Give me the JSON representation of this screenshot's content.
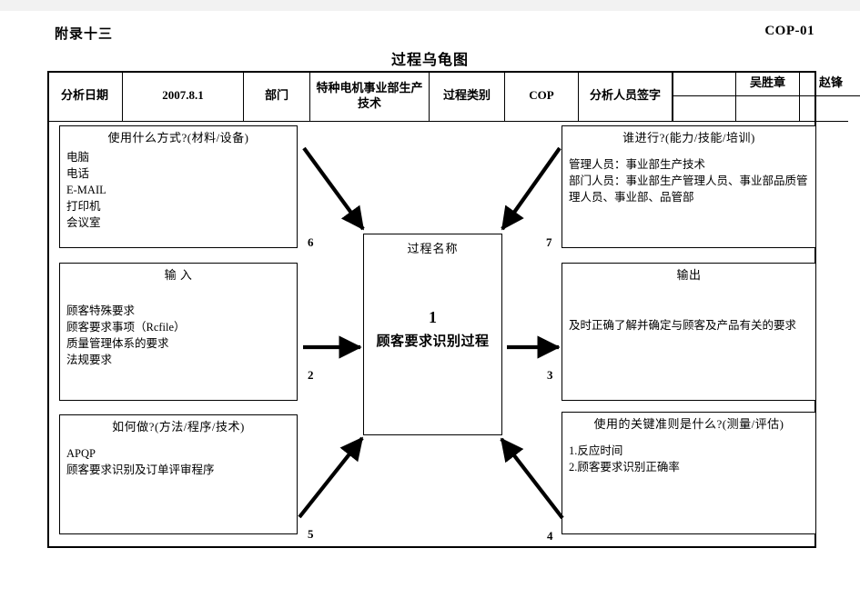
{
  "page": {
    "appendix_label": "附录十三",
    "doc_code": "COP-01",
    "title": "过程乌龟图"
  },
  "header": {
    "date_label": "分析日期",
    "date_value": "2007.8.1",
    "dept_label": "部门",
    "dept_value": "特种电机事业部生产技术",
    "process_type_label": "过程类别",
    "process_type_value": "COP",
    "signature_label": "分析人员签字",
    "signature_cells": [
      {
        "blank": "",
        "name": "吴胜章",
        "name2": "赵锋"
      }
    ],
    "signer_blank": "",
    "signer_1": "吴胜章",
    "signer_2": "赵锋",
    "signer_row2_blank1": "",
    "signer_row2_blank2": "",
    "signer_row2_blank3": ""
  },
  "turtle": {
    "methods": {
      "title": "使用什么方式?(材料/设备)",
      "lines": [
        "电脑",
        "电话",
        "E-MAIL",
        "打印机",
        "会议室"
      ]
    },
    "who": {
      "title": "谁进行?(能力/技能/培训)",
      "lines": [
        "管理人员：事业部生产技术",
        "部门人员：事业部生产管理人员、事业部品质管",
        "理人员、事业部、品管部"
      ]
    },
    "input": {
      "title": "输  入",
      "lines": [
        "顾客特殊要求",
        "顾客要求事项（Rcfile）",
        "质量管理体系的要求",
        "法规要求"
      ]
    },
    "output": {
      "title": "输出",
      "lines": [
        "及时正确了解并确定与顾客及产品有关的要求"
      ]
    },
    "how": {
      "title": "如何做?(方法/程序/技术)",
      "lines": [
        "APQP",
        "顾客要求识别及订单评审程序"
      ]
    },
    "criteria": {
      "title": "使用的关键准则是什么?(测量/评估)",
      "lines": [
        "1.反应时间",
        "2.顾客要求识别正确率"
      ]
    },
    "center": {
      "title": "过程名称",
      "number": "1",
      "name": "顾客要求识别过程"
    }
  },
  "arrow_labels": {
    "n2": "2",
    "n3": "3",
    "n4": "4",
    "n5": "5",
    "n6": "6",
    "n7": "7"
  },
  "colors": {
    "line": "#000000",
    "background": "#ffffff",
    "topbar": "#f2f2f2"
  }
}
